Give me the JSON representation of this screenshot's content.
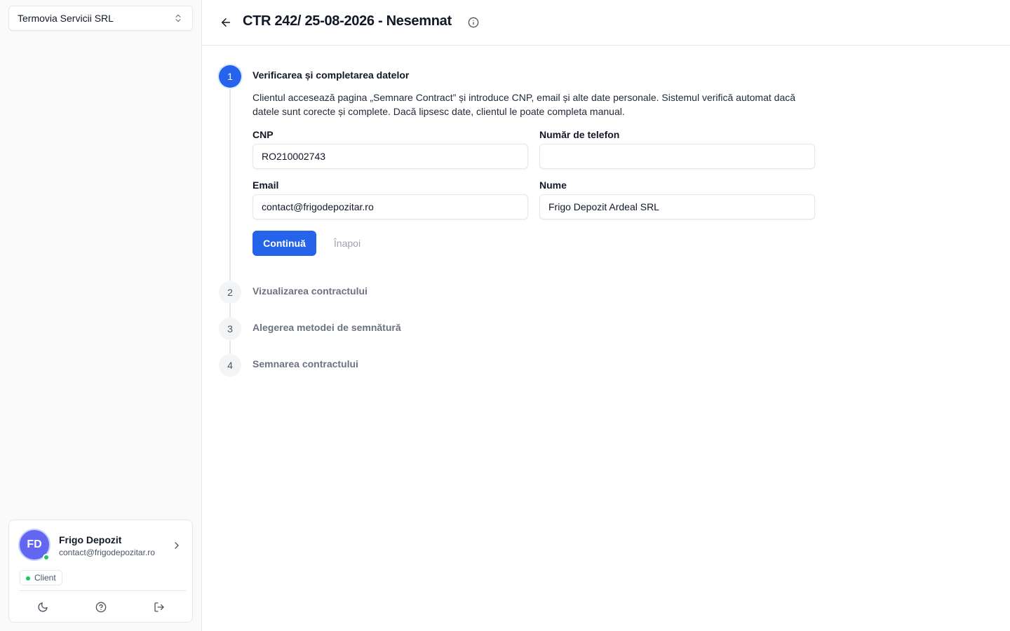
{
  "sidebar": {
    "org_select": {
      "label": "Termovia Servicii SRL"
    },
    "user": {
      "initials": "FD",
      "name": "Frigo Depozit",
      "email": "contact@frigodepozitar.ro",
      "role": "Client",
      "status_color": "#22c55e",
      "avatar_color": "#6366f1"
    },
    "actions": [
      "moon-icon",
      "help-circle-icon",
      "logout-icon"
    ]
  },
  "header": {
    "title": "CTR 242/ 25-08-2026 - Nesemnat"
  },
  "stepper": {
    "accent_color": "#2563eb",
    "steps": [
      {
        "number": "1",
        "title": "Verificarea și completarea datelor",
        "state": "active",
        "description": "Clientul accesează pagina „Semnare Contract” și introduce CNP, email și alte date personale. Sistemul verifică automat dacă datele sunt corecte și complete. Dacă lipsesc date, clientul le poate completa manual."
      },
      {
        "number": "2",
        "title": "Vizualizarea contractului",
        "state": "pending"
      },
      {
        "number": "3",
        "title": "Alegerea metodei de semnătură",
        "state": "pending"
      },
      {
        "number": "4",
        "title": "Semnarea contractului",
        "state": "pending"
      }
    ]
  },
  "form": {
    "cnp": {
      "label": "CNP",
      "value": "RO210002743"
    },
    "phone": {
      "label": "Număr de telefon",
      "value": ""
    },
    "email": {
      "label": "Email",
      "value": "contact@frigodepozitar.ro"
    },
    "name": {
      "label": "Nume",
      "value": "Frigo Depozit Ardeal SRL"
    },
    "continue_label": "Continuă",
    "back_label": "Înapoi"
  }
}
